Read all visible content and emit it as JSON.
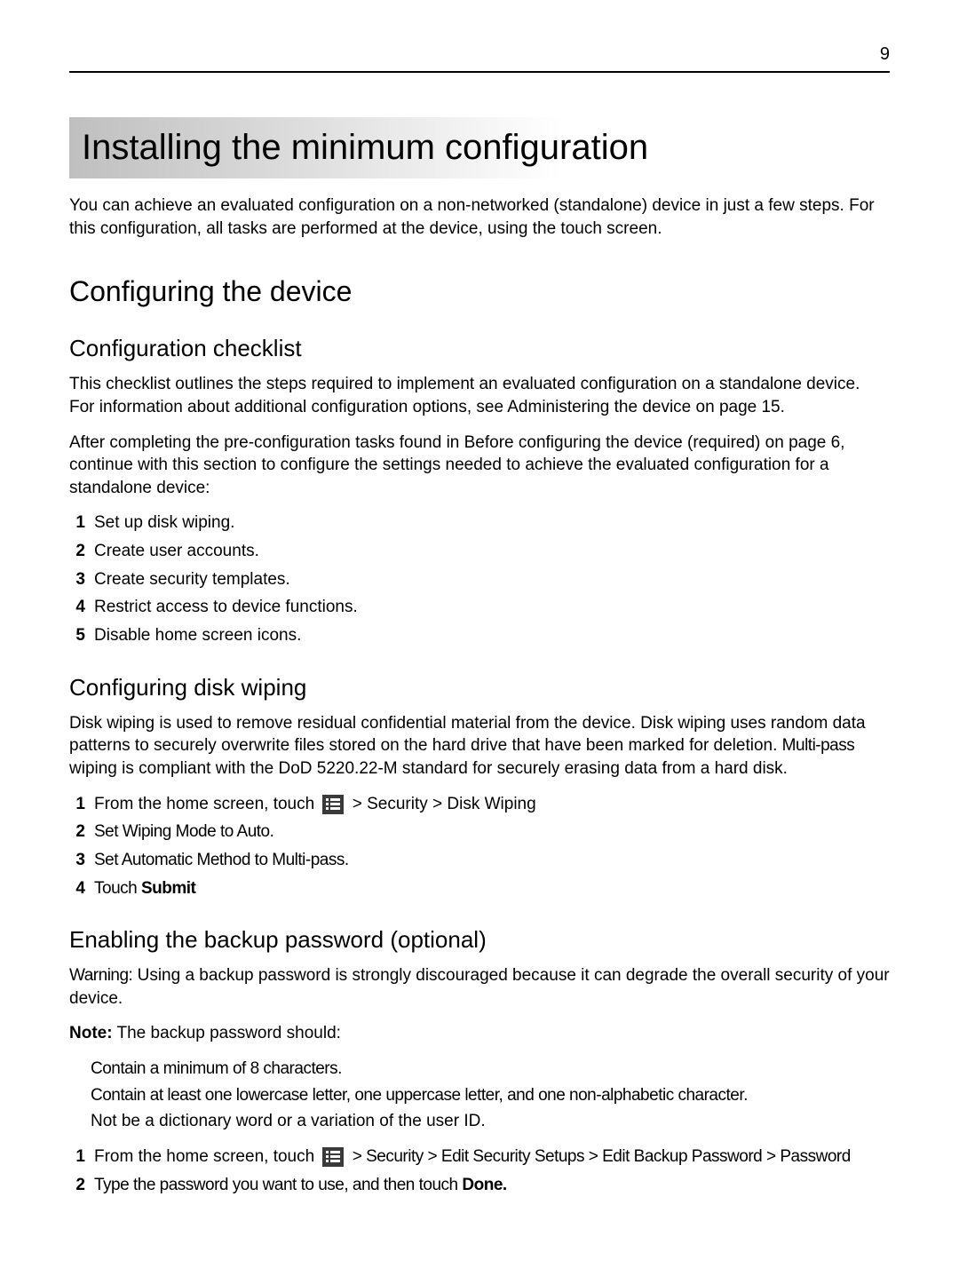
{
  "page_number": "9",
  "title": "Installing the minimum configuration",
  "intro": "You can achieve an evaluated configuration on a non-networked (standalone) device in just a few steps. For this configuration, all tasks are performed at the device, using the touch screen.",
  "section_configuring_device": "Configuring the device",
  "checklist_heading": "Configuration checklist",
  "checklist_p1a": "This checklist outlines the steps required to implement an evaluated configuration on a standalone device. For information about additional configuration options, see  Administering the device  on page 15.",
  "checklist_p2": "After completing the pre‑configuration tasks found in  Before configuring the device (required)  on page 6, continue with this section to configure the settings needed to achieve the evaluated configuration for a standalone device:",
  "checklist_items": [
    "Set up disk wiping.",
    "Create user accounts.",
    "Create security templates.",
    "Restrict access to device functions.",
    "Disable home screen icons."
  ],
  "disk_heading": "Configuring disk wiping",
  "disk_p_a": "Disk wiping is used to remove residual confidential material from the device. Disk wiping uses random data patterns to securely overwrite files stored on the hard drive that have been marked for deletion. ",
  "disk_p_b": "Multi‑pass",
  "disk_p_c": " wiping is compliant with the DoD 5220.22‑M standard for securely erasing data from a hard disk.",
  "disk_steps": {
    "s1_a": "From the home screen, touch ",
    "s1_b": " > Security > Disk Wiping",
    "s2": "Set Wiping Mode to Auto.",
    "s3": "Set Automatic Method to Multi‑pass.",
    "s4_a": "Touch ",
    "s4_b": "Submit"
  },
  "backup_heading": "Enabling the backup password (optional)",
  "backup_warning_label": "Warning:",
  "backup_warning_text": " Using a backup password is strongly discouraged because it can degrade the overall security of your device.",
  "backup_note_label": "Note:",
  "backup_note_text": " The backup password should:",
  "backup_bullets": [
    "Contain a minimum of 8 characters.",
    "Contain at least one lowercase letter, one uppercase letter, and one non‑alphabetic character.",
    "Not be a dictionary word or a variation of the user ID."
  ],
  "backup_steps": {
    "s1_a": "From the home screen, touch ",
    "s1_b": " > Security > Edit Security Setups > Edit Backup Password > Password",
    "s2_a": "Type the password you want to use, and then touch ",
    "s2_b": "Done."
  }
}
